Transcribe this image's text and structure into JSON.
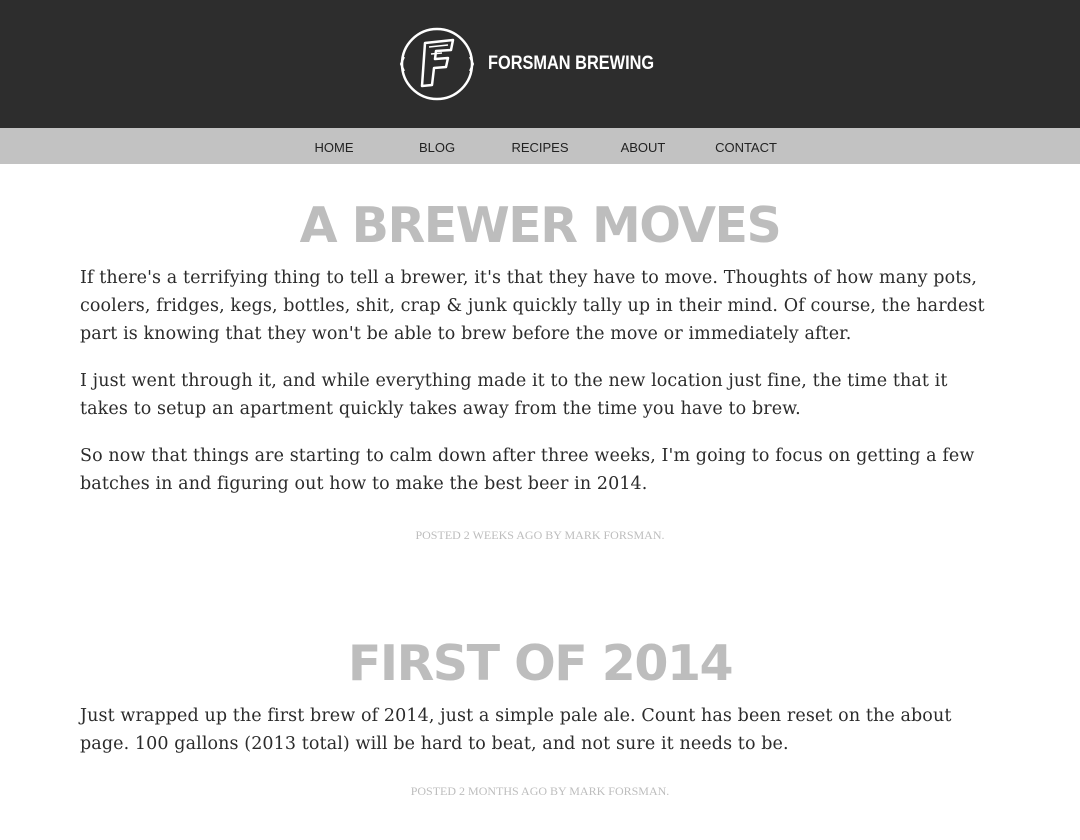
{
  "site": {
    "name": "FORSMAN BREWING",
    "logo_icon": "forsman-f-circle-logo",
    "colors": {
      "header_bg": "#2d2d2d",
      "nav_bg": "#c2c2c2",
      "title_gray": "#bdbdbd",
      "body_text": "#2b2b2b"
    }
  },
  "nav": {
    "items": [
      {
        "label": "HOME"
      },
      {
        "label": "BLOG"
      },
      {
        "label": "RECIPES"
      },
      {
        "label": "ABOUT"
      },
      {
        "label": "CONTACT"
      }
    ]
  },
  "posts": [
    {
      "title": "A BREWER MOVES",
      "paragraphs": [
        "If there's a terrifying thing to tell a brewer, it's that they have to move. Thoughts of how many pots, coolers, fridges, kegs, bottles, shit, crap & junk quickly tally up in their mind. Of course, the hardest part is knowing that they won't be able to brew before the move or immediately after.",
        "I just went through it, and while everything made it to the new location just fine, the time that it takes to setup an apartment quickly takes away from the time you have to brew.",
        "So now that things are starting to calm down after three weeks, I'm going to focus on getting a few batches in and figuring out how to make the best beer in 2014."
      ],
      "meta": "POSTED 2 WEEKS AGO BY MARK FORSMAN."
    },
    {
      "title": "FIRST OF 2014",
      "paragraphs": [
        "Just wrapped up the first brew of 2014, just a simple pale ale. Count has been reset on the about page. 100 gallons (2013 total) will be hard to beat, and not sure it needs to be."
      ],
      "meta": "POSTED 2 MONTHS AGO BY MARK FORSMAN."
    }
  ]
}
